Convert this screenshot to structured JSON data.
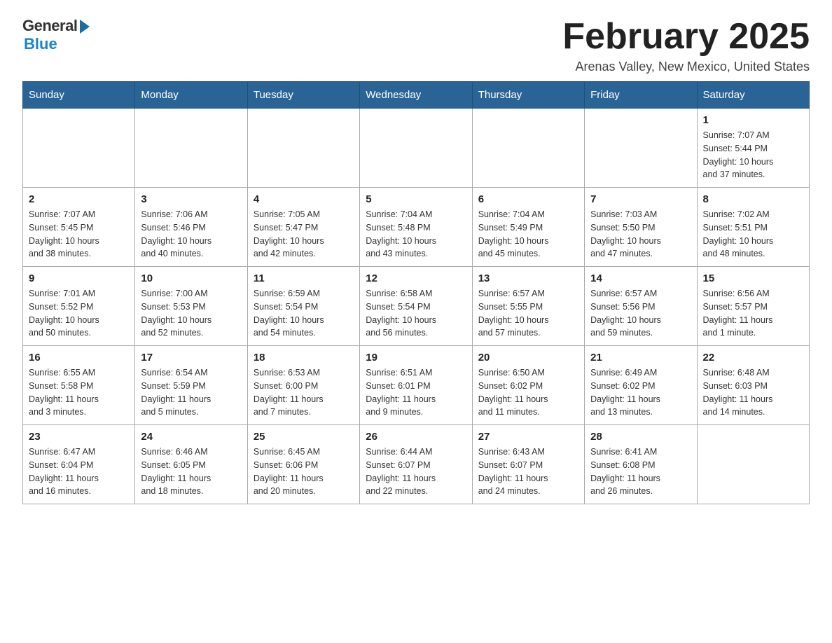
{
  "header": {
    "logo_general": "General",
    "logo_blue": "Blue",
    "title": "February 2025",
    "location": "Arenas Valley, New Mexico, United States"
  },
  "days_of_week": [
    "Sunday",
    "Monday",
    "Tuesday",
    "Wednesday",
    "Thursday",
    "Friday",
    "Saturday"
  ],
  "weeks": [
    [
      {
        "day": "",
        "info": ""
      },
      {
        "day": "",
        "info": ""
      },
      {
        "day": "",
        "info": ""
      },
      {
        "day": "",
        "info": ""
      },
      {
        "day": "",
        "info": ""
      },
      {
        "day": "",
        "info": ""
      },
      {
        "day": "1",
        "info": "Sunrise: 7:07 AM\nSunset: 5:44 PM\nDaylight: 10 hours\nand 37 minutes."
      }
    ],
    [
      {
        "day": "2",
        "info": "Sunrise: 7:07 AM\nSunset: 5:45 PM\nDaylight: 10 hours\nand 38 minutes."
      },
      {
        "day": "3",
        "info": "Sunrise: 7:06 AM\nSunset: 5:46 PM\nDaylight: 10 hours\nand 40 minutes."
      },
      {
        "day": "4",
        "info": "Sunrise: 7:05 AM\nSunset: 5:47 PM\nDaylight: 10 hours\nand 42 minutes."
      },
      {
        "day": "5",
        "info": "Sunrise: 7:04 AM\nSunset: 5:48 PM\nDaylight: 10 hours\nand 43 minutes."
      },
      {
        "day": "6",
        "info": "Sunrise: 7:04 AM\nSunset: 5:49 PM\nDaylight: 10 hours\nand 45 minutes."
      },
      {
        "day": "7",
        "info": "Sunrise: 7:03 AM\nSunset: 5:50 PM\nDaylight: 10 hours\nand 47 minutes."
      },
      {
        "day": "8",
        "info": "Sunrise: 7:02 AM\nSunset: 5:51 PM\nDaylight: 10 hours\nand 48 minutes."
      }
    ],
    [
      {
        "day": "9",
        "info": "Sunrise: 7:01 AM\nSunset: 5:52 PM\nDaylight: 10 hours\nand 50 minutes."
      },
      {
        "day": "10",
        "info": "Sunrise: 7:00 AM\nSunset: 5:53 PM\nDaylight: 10 hours\nand 52 minutes."
      },
      {
        "day": "11",
        "info": "Sunrise: 6:59 AM\nSunset: 5:54 PM\nDaylight: 10 hours\nand 54 minutes."
      },
      {
        "day": "12",
        "info": "Sunrise: 6:58 AM\nSunset: 5:54 PM\nDaylight: 10 hours\nand 56 minutes."
      },
      {
        "day": "13",
        "info": "Sunrise: 6:57 AM\nSunset: 5:55 PM\nDaylight: 10 hours\nand 57 minutes."
      },
      {
        "day": "14",
        "info": "Sunrise: 6:57 AM\nSunset: 5:56 PM\nDaylight: 10 hours\nand 59 minutes."
      },
      {
        "day": "15",
        "info": "Sunrise: 6:56 AM\nSunset: 5:57 PM\nDaylight: 11 hours\nand 1 minute."
      }
    ],
    [
      {
        "day": "16",
        "info": "Sunrise: 6:55 AM\nSunset: 5:58 PM\nDaylight: 11 hours\nand 3 minutes."
      },
      {
        "day": "17",
        "info": "Sunrise: 6:54 AM\nSunset: 5:59 PM\nDaylight: 11 hours\nand 5 minutes."
      },
      {
        "day": "18",
        "info": "Sunrise: 6:53 AM\nSunset: 6:00 PM\nDaylight: 11 hours\nand 7 minutes."
      },
      {
        "day": "19",
        "info": "Sunrise: 6:51 AM\nSunset: 6:01 PM\nDaylight: 11 hours\nand 9 minutes."
      },
      {
        "day": "20",
        "info": "Sunrise: 6:50 AM\nSunset: 6:02 PM\nDaylight: 11 hours\nand 11 minutes."
      },
      {
        "day": "21",
        "info": "Sunrise: 6:49 AM\nSunset: 6:02 PM\nDaylight: 11 hours\nand 13 minutes."
      },
      {
        "day": "22",
        "info": "Sunrise: 6:48 AM\nSunset: 6:03 PM\nDaylight: 11 hours\nand 14 minutes."
      }
    ],
    [
      {
        "day": "23",
        "info": "Sunrise: 6:47 AM\nSunset: 6:04 PM\nDaylight: 11 hours\nand 16 minutes."
      },
      {
        "day": "24",
        "info": "Sunrise: 6:46 AM\nSunset: 6:05 PM\nDaylight: 11 hours\nand 18 minutes."
      },
      {
        "day": "25",
        "info": "Sunrise: 6:45 AM\nSunset: 6:06 PM\nDaylight: 11 hours\nand 20 minutes."
      },
      {
        "day": "26",
        "info": "Sunrise: 6:44 AM\nSunset: 6:07 PM\nDaylight: 11 hours\nand 22 minutes."
      },
      {
        "day": "27",
        "info": "Sunrise: 6:43 AM\nSunset: 6:07 PM\nDaylight: 11 hours\nand 24 minutes."
      },
      {
        "day": "28",
        "info": "Sunrise: 6:41 AM\nSunset: 6:08 PM\nDaylight: 11 hours\nand 26 minutes."
      },
      {
        "day": "",
        "info": ""
      }
    ]
  ]
}
